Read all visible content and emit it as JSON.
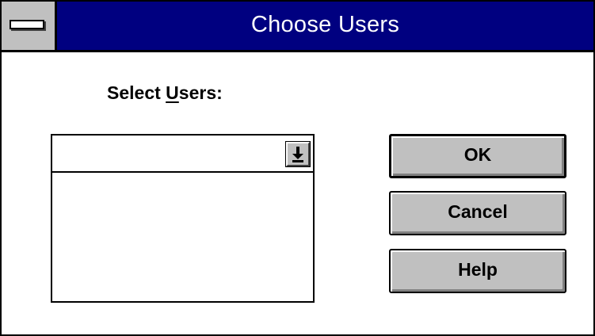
{
  "window": {
    "title": "Choose Users"
  },
  "form": {
    "label_before": "Select ",
    "label_mnemonic": "U",
    "label_after": "sers:",
    "users_combo_value": ""
  },
  "buttons": {
    "ok": "OK",
    "cancel": "Cancel",
    "help": "Help"
  },
  "icons": {
    "system_menu": "system-menu-icon",
    "dropdown": "arrow-down-icon"
  },
  "colors": {
    "titlebar": "#000080",
    "button_face": "#c0c0c0",
    "background": "#ffffff"
  }
}
